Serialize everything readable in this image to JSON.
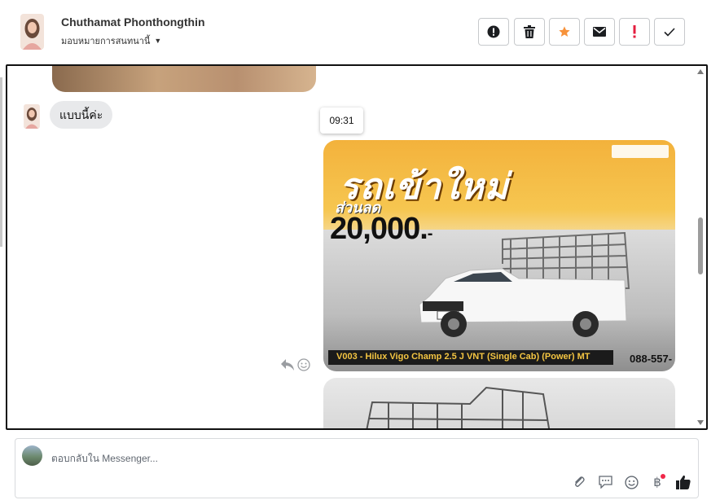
{
  "header": {
    "contact_name": "Chuthamat Phonthongthin",
    "assign_label": "มอบหมายการสนทนานี้",
    "toolbar": [
      {
        "name": "spam-button",
        "icon": "alert-circle-icon"
      },
      {
        "name": "delete-button",
        "icon": "trash-icon"
      },
      {
        "name": "star-button",
        "icon": "star-icon",
        "color": "#f7923a"
      },
      {
        "name": "mark-unread-button",
        "icon": "envelope-icon"
      },
      {
        "name": "flag-button",
        "icon": "exclamation-icon",
        "color": "#e41e3f"
      },
      {
        "name": "done-button",
        "icon": "check-icon"
      }
    ]
  },
  "chat": {
    "incoming_message": "แบบนี้ค่ะ",
    "timestamp_tooltip": "09:31",
    "ad_image": {
      "headline": "รถเข้าใหม่",
      "discount_label": "ส่วนลด",
      "price": "20,000.",
      "price_suffix": "-",
      "caption": "V003 - Hilux Vigo Champ 2.5 J VNT (Single Cab) (Power) MT",
      "phone": "088-557-"
    }
  },
  "reply": {
    "placeholder": "ตอบกลับใน Messenger..."
  },
  "colors": {
    "accent_star": "#f7923a",
    "flag_red": "#e41e3f",
    "badge_red": "#f02849"
  }
}
